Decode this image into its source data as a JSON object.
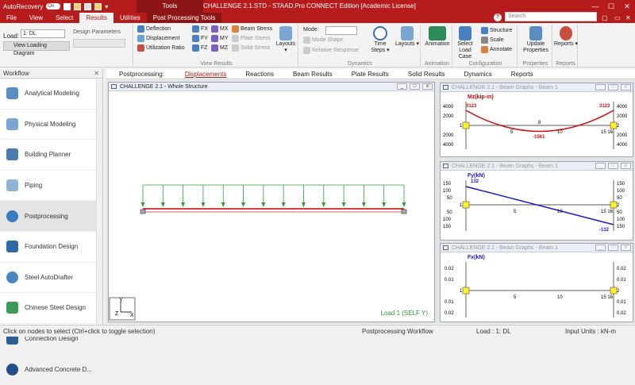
{
  "titlebar": {
    "autorecovery_label": "AutoRecovery",
    "toggle_state": "On",
    "context_tab": "Tools",
    "title": "CHALLENGE 2.1.STD - STAAD.Pro CONNECT Edition [Academic License]"
  },
  "ribbon_tabs": [
    "File",
    "View",
    "Select",
    "Results",
    "Utilities",
    "Post Processing Tools"
  ],
  "search_placeholder": "Search",
  "ribbon": {
    "load_label": "Load:",
    "load_value": "1: DL",
    "design_params_label": "Design Parameters",
    "view_loading_diagram": "View Loading Diagram",
    "view_results": {
      "deflection": "Deflection",
      "displacement": "Displacement",
      "utilization_ratio": "Utilization Ratio",
      "fx": "FX",
      "fy": "FY",
      "fz": "FZ",
      "mx": "MX",
      "my": "MY",
      "mz": "MZ",
      "beam_stress": "Beam Stress",
      "plate_stress": "Plate Stress",
      "solid_stress": "Solid Stress",
      "layouts": "Layouts",
      "group_label": "View Results"
    },
    "dynamics": {
      "mode_label": "Mode:",
      "mode_shape": "Mode Shape",
      "relative_response": "Relative Response",
      "time_steps": "Time Steps",
      "layouts": "Layouts",
      "group_label": "Dynamics"
    },
    "animation": {
      "label": "Animation",
      "group_label": "Animation"
    },
    "configuration": {
      "select_load_case": "Select Load Case",
      "structure": "Structure",
      "scale": "Scale",
      "annotate": "Annotate",
      "group_label": "Configuration"
    },
    "properties": {
      "update_properties": "Update Properties",
      "group_label": "Properties"
    },
    "reports": {
      "label": "Reports",
      "group_label": "Reports"
    }
  },
  "workflow": {
    "title": "Workflow",
    "items": [
      {
        "label": "Analytical Modeling",
        "color": "#5a8fc4"
      },
      {
        "label": "Physical Modeling",
        "color": "#7aa6d6"
      },
      {
        "label": "Building Planner",
        "color": "#4b7bb0"
      },
      {
        "label": "Piping",
        "color": "#8fb3d9"
      },
      {
        "label": "Postprocessing",
        "color": "#3a7bbf"
      },
      {
        "label": "Foundation Design",
        "color": "#2f6aa8"
      },
      {
        "label": "Steel AutoDrafter",
        "color": "#4a86c0"
      },
      {
        "label": "Chinese Steel Design",
        "color": "#3b9a5a"
      },
      {
        "label": "Connection Design",
        "color": "#2d5f96"
      },
      {
        "label": "Advanced Concrete D...",
        "color": "#1f4f86"
      }
    ]
  },
  "postprocessing_tabs": {
    "label": "Postprocessing:",
    "tabs": [
      "Displacements",
      "Reactions",
      "Beam Results",
      "Plate Results",
      "Solid Results",
      "Dynamics",
      "Reports"
    ]
  },
  "structure_window": {
    "title": "CHALLENGE 2.1 - Whole Structure",
    "load_label": "Load 1 (SELF Y)",
    "axis_y": "Y",
    "axis_x": "X",
    "axis_z": "Z"
  },
  "graph_mz": {
    "title": "CHALLENGE 2.1 - Beam Graphs - Beam 1",
    "label": "Mz(kip-in)",
    "left_value": "3123",
    "right_value": "3123",
    "min_value": "-1561",
    "left_ticks": [
      "4000",
      "2000",
      "1",
      "2000",
      "4000"
    ],
    "right_ticks": [
      "4000",
      "2000",
      "2",
      "2000",
      "4000"
    ],
    "x_ticks": [
      "5",
      "8",
      "10",
      "15 16"
    ]
  },
  "graph_fy": {
    "title": "CHALLENGE 2.1 - Beam Graphs - Beam 1",
    "label": "Fy(kN)",
    "left_value": "132",
    "right_value": "-132",
    "left_ticks": [
      "150",
      "100",
      "50",
      "1",
      "50",
      "100",
      "150"
    ],
    "right_ticks": [
      "150",
      "100",
      "50",
      "2",
      "50",
      "100",
      "150"
    ],
    "x_ticks": [
      "5",
      "10",
      "15 16"
    ]
  },
  "graph_fx": {
    "title": "CHALLENGE 2.1 - Beam Graphs - Beam 1",
    "label": "Fx(kN)",
    "left_ticks": [
      "0.02",
      "0.01",
      "1",
      "0.01",
      "0.02"
    ],
    "right_ticks": [
      "0.02",
      "0.01",
      "2",
      "0.01",
      "0.02"
    ],
    "x_ticks": [
      "5",
      "10",
      "15 16"
    ]
  },
  "statusbar": {
    "hint": "Click on nodes to select (Ctrl+click to toggle selection)",
    "workflow": "Postprocessing Workflow",
    "load": "Load : 1: DL",
    "units": "Input Units : kN-m"
  }
}
